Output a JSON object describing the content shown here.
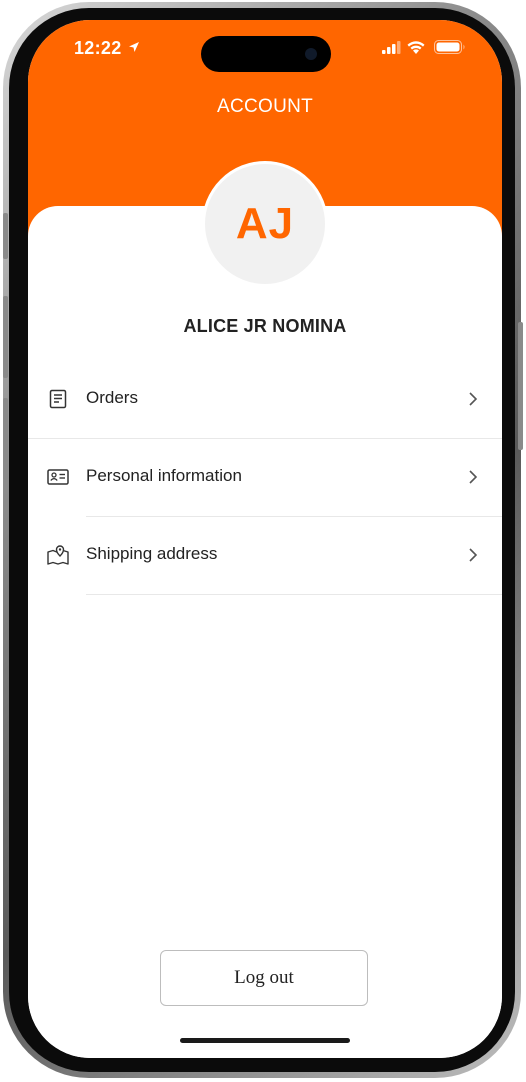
{
  "status_bar": {
    "time": "12:22"
  },
  "header": {
    "title": "ACCOUNT",
    "background_color": "#ff6600"
  },
  "profile": {
    "initials": "AJ",
    "name": "ALICE JR NOMINA",
    "accent_color": "#ff6600"
  },
  "menu": {
    "items": [
      {
        "label": "Orders",
        "icon": "receipt-icon"
      },
      {
        "label": "Personal information",
        "icon": "id-card-icon"
      },
      {
        "label": "Shipping address",
        "icon": "map-pin-icon"
      }
    ]
  },
  "actions": {
    "logout_label": "Log out"
  }
}
